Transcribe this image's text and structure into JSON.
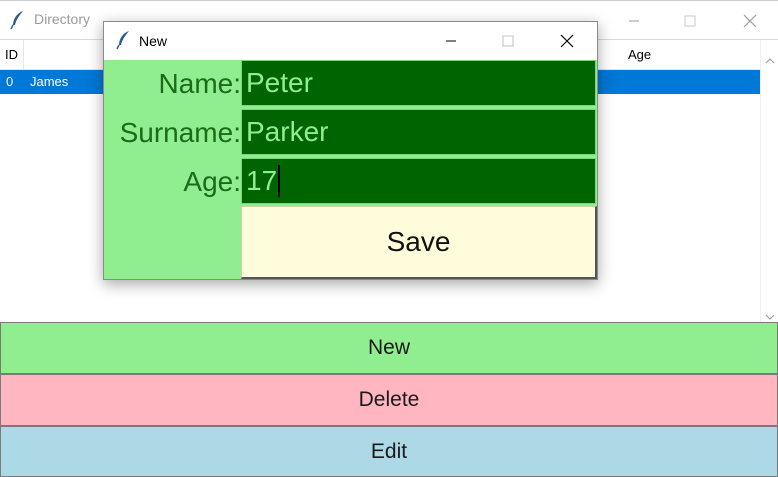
{
  "main_window": {
    "title": "Directory",
    "columns": {
      "id": "ID",
      "age": "Age"
    },
    "rows": [
      {
        "id": "0",
        "name": "James",
        "selected": true
      }
    ],
    "buttons": {
      "new": "New",
      "delete": "Delete",
      "edit": "Edit"
    }
  },
  "dialog": {
    "title": "New",
    "labels": {
      "name": "Name:",
      "surname": "Surname:",
      "age": "Age:"
    },
    "values": {
      "name": "Peter",
      "surname": "Parker",
      "age": "17"
    },
    "save_label": "Save"
  },
  "colors": {
    "selection": "#0078d7",
    "new_button": "#90ee90",
    "delete_button": "#ffb6c1",
    "edit_button": "#add8e6",
    "dialog_bg": "#90ee90",
    "entry_bg": "#006400",
    "save_button": "#fffcdc"
  },
  "icons": {
    "app": "feather-icon"
  }
}
